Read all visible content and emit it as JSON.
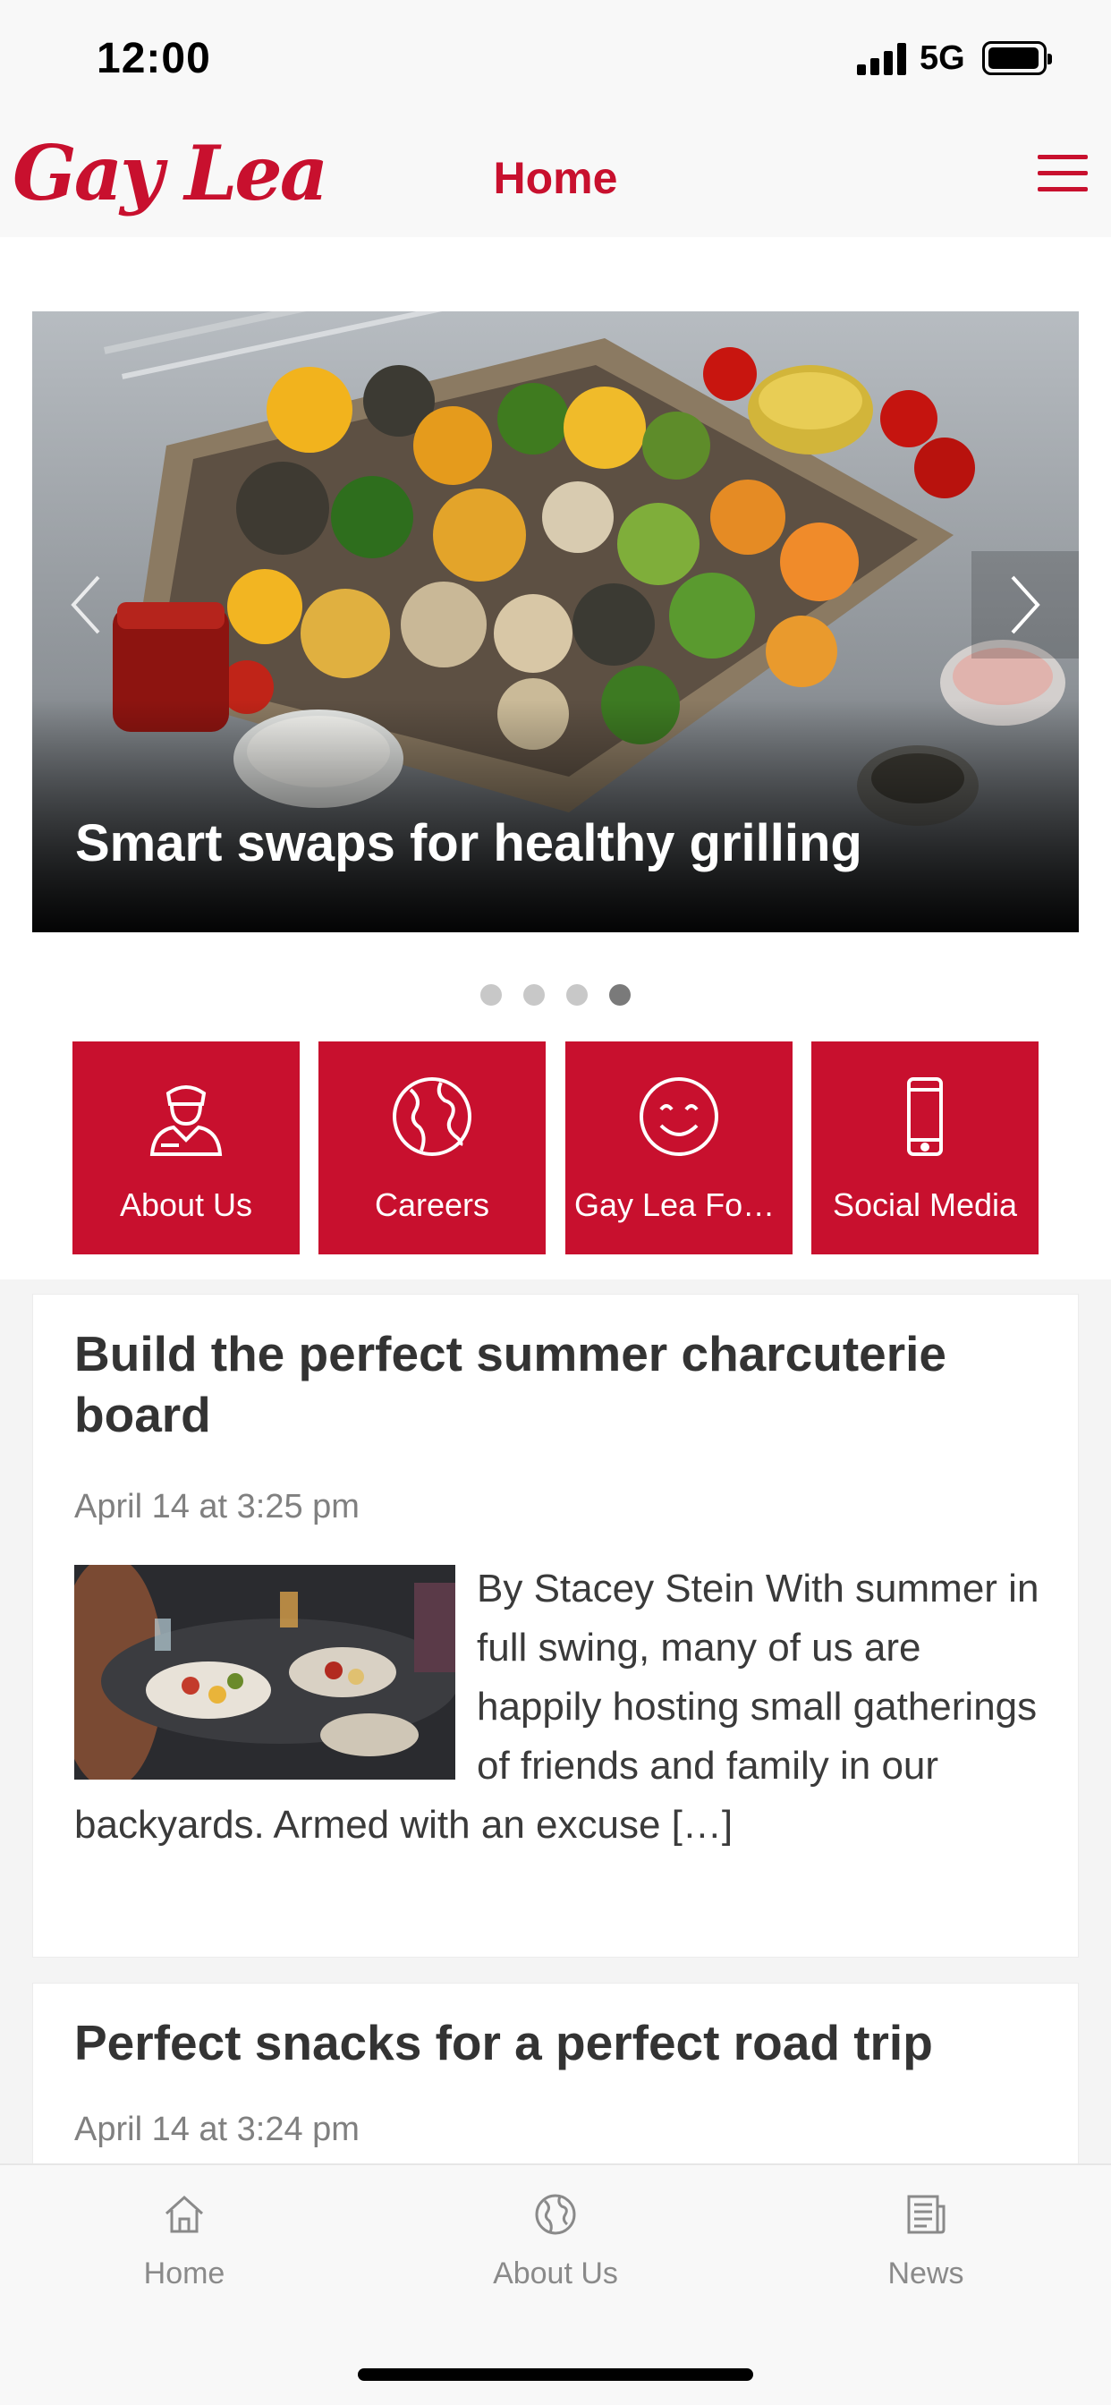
{
  "status_bar": {
    "time": "12:00",
    "network": "5G"
  },
  "header": {
    "logo_text": "Gay Lea",
    "title": "Home",
    "menu_icon": "hamburger-menu-icon"
  },
  "carousel": {
    "caption": "Smart swaps for healthy grilling",
    "slide_count": 4,
    "active_slide": 4,
    "prev_icon": "chevron-left-icon",
    "next_icon": "chevron-right-icon"
  },
  "quick_links": [
    {
      "label": "About Us",
      "icon": "person-icon"
    },
    {
      "label": "Careers",
      "icon": "globe-icon"
    },
    {
      "label": "Gay Lea Fou...",
      "icon": "smiley-icon"
    },
    {
      "label": "Social Media",
      "icon": "phone-icon"
    }
  ],
  "articles": [
    {
      "title": "Build the perfect summer charcuterie board",
      "date": "April 14 at 3:25 pm",
      "excerpt": "By Stacey Stein With summer in full swing, many of us are happily hosting small gatherings of friends and family in our backyards. Armed with an excuse […]"
    },
    {
      "title": "Perfect snacks for a perfect road trip",
      "date": "April 14 at 3:24 pm"
    }
  ],
  "tab_bar": [
    {
      "label": "Home",
      "icon": "home-icon"
    },
    {
      "label": "About Us",
      "icon": "globe-icon"
    },
    {
      "label": "News",
      "icon": "news-icon"
    }
  ],
  "colors": {
    "brand": "#c8102e",
    "tile": "#c8102e",
    "muted": "#808080"
  }
}
